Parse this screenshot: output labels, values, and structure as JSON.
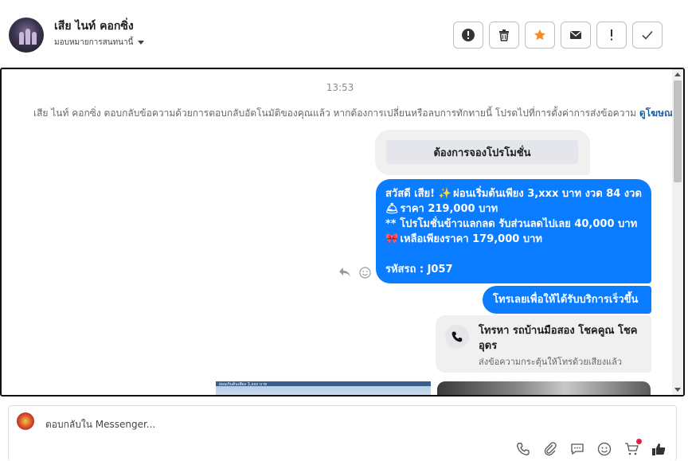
{
  "header": {
    "name": "เสีย ไนท์ คอกซิ่ง",
    "assign_label": "มอบหมายการสนทนานี้",
    "actions": [
      "report",
      "delete",
      "star",
      "mark-unread",
      "spam",
      "done"
    ]
  },
  "thread": {
    "time": "13:53",
    "notice": "เสีย ไนท์ คอกซิ่ง ตอบกลับข้อความด้วยการตอบกลับอัตโนมัติของคุณแล้ว หากต้องการเปลี่ยนหรือลบการทักทายนี้ โปรดไปที่การตั้งค่าการส่งข้อความ",
    "notice_link": "ดูโฆษณา",
    "quick_reply": "ต้องการจองโปรโมชั่น",
    "message_lines": [
      "สวัสดี เสีย!",
      "ผ่อนเริ่มต้นเพียง 3,xxx บาท งวด 84 งวด",
      "ราคา 219,000 บาท",
      "** โปรโมชั่นข้าวแลกลด รับส่วนลดไปเลย 40,000 บาท",
      "เหลือเพียงราคา 179,000 บาท",
      "รหัสรถ : J057"
    ],
    "message2": "โทรเลยเพื่อให้ได้รับบริการเร็วขึ้น",
    "call_title": "โทรหา รถบ้านมือสอง โชคคูณ โชคอุดร",
    "call_sub": "ส่งข้อความกระตุ้นให้โทรด้วยเสียงแล้ว",
    "image_caption": "ผ่อนเริ่มต้นเพียง 3,xxx บาท"
  },
  "composer": {
    "placeholder": "ตอบกลับใน Messenger..."
  },
  "colors": {
    "accent": "#0a7cff",
    "star": "#f28c28",
    "badge": "#e41e3f"
  }
}
